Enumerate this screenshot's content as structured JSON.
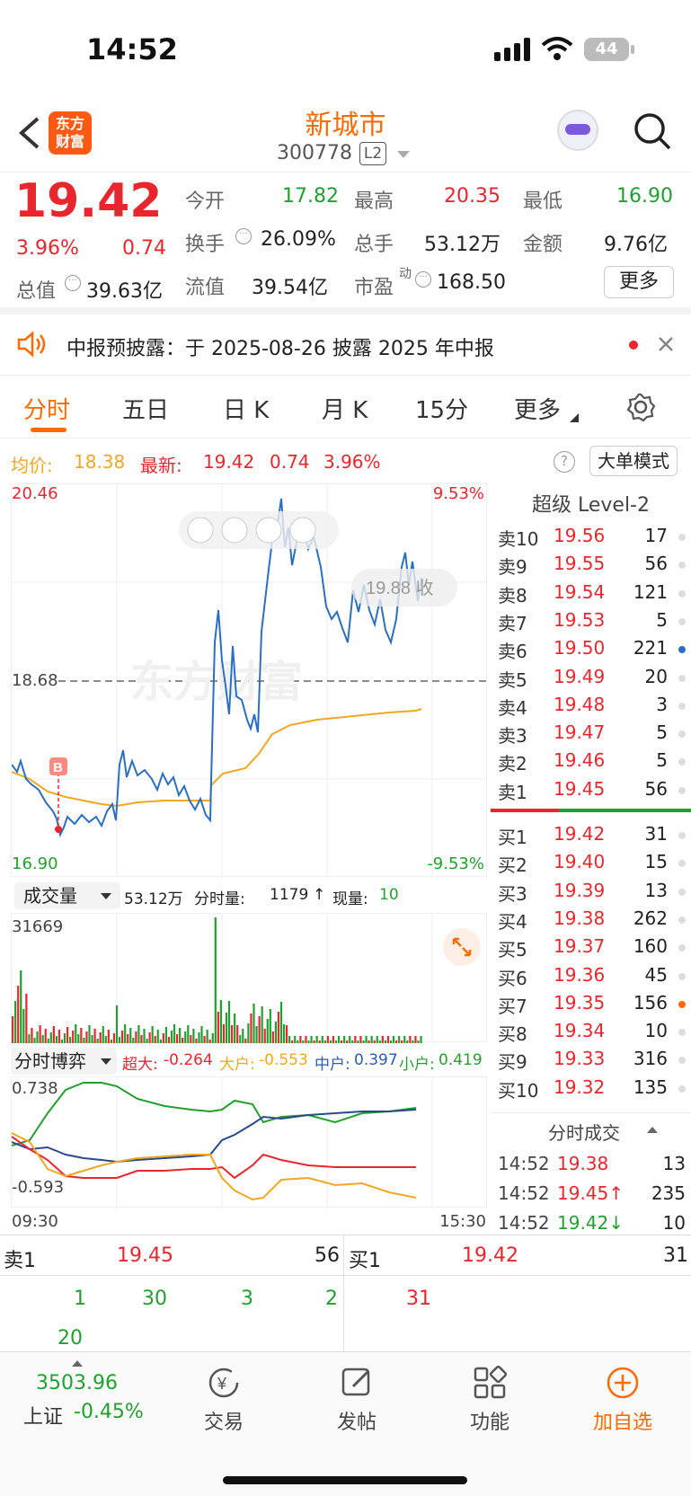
{
  "status_bar": {
    "time": "14:52",
    "battery": "44"
  },
  "header": {
    "logo_line1": "东方",
    "logo_line2": "财富",
    "stock_name": "新城市",
    "stock_code": "300778",
    "level_badge": "L2"
  },
  "quote": {
    "price": "19.42",
    "change_pct": "3.96%",
    "change": "0.74",
    "open_label": "今开",
    "open": "17.82",
    "high_label": "最高",
    "high": "20.35",
    "low_label": "最低",
    "low": "16.90",
    "turnover_label": "换手",
    "turnover": "26.09%",
    "volume_label": "总手",
    "volume": "53.12万",
    "amount_label": "金额",
    "amount": "9.76亿",
    "mktcap_label": "总值",
    "mktcap": "39.63亿",
    "float_label": "流值",
    "float": "39.54亿",
    "pe_label": "市盈",
    "pe_sup": "动",
    "pe": "168.50",
    "more_button": "更多"
  },
  "notice": {
    "text": "中报预披露：于 2025-08-26 披露 2025 年中报"
  },
  "tabs": [
    "分时",
    "五日",
    "日 K",
    "月 K",
    "15分",
    "更多"
  ],
  "avg_line": {
    "avg_label": "均价:",
    "avg": "18.38",
    "latest_label": "最新:",
    "latest": "19.42",
    "latest_chg": "0.74",
    "latest_pct": "3.96%",
    "big_order_button": "大单模式"
  },
  "chart": {
    "y_max": "20.46",
    "y_min": "16.90",
    "pct_max": "9.53%",
    "pct_min": "-9.53%",
    "prev_close": "18.68",
    "close_tag": "19.88 收",
    "buy_marker": "B",
    "watermark": "东方财富",
    "time_start": "09:30",
    "time_end": "15:30"
  },
  "volume_bar": {
    "dropdown": "成交量",
    "total": "53.12万",
    "tick_label": "分时量:",
    "tick_vol": "1179",
    "now_label": "现量:",
    "now_vol": "10",
    "y_max": "31669"
  },
  "bo_bar": {
    "dropdown": "分时博弈",
    "super_label": "超大:",
    "super": "-0.264",
    "large_label": "大户:",
    "large": "-0.553",
    "mid_label": "中户:",
    "mid": "0.397",
    "small_label": "小户:",
    "small": "0.419",
    "y_max": "0.738",
    "y_min": "-0.593"
  },
  "orderbook": {
    "title": "超级 Level-2",
    "asks": [
      {
        "label": "卖10",
        "price": "19.56",
        "vol": "17"
      },
      {
        "label": "卖9",
        "price": "19.55",
        "vol": "56"
      },
      {
        "label": "卖8",
        "price": "19.54",
        "vol": "121"
      },
      {
        "label": "卖7",
        "price": "19.53",
        "vol": "5"
      },
      {
        "label": "卖6",
        "price": "19.50",
        "vol": "221"
      },
      {
        "label": "卖5",
        "price": "19.49",
        "vol": "20"
      },
      {
        "label": "卖4",
        "price": "19.48",
        "vol": "3"
      },
      {
        "label": "卖3",
        "price": "19.47",
        "vol": "5"
      },
      {
        "label": "卖2",
        "price": "19.46",
        "vol": "5"
      },
      {
        "label": "卖1",
        "price": "19.45",
        "vol": "56"
      }
    ],
    "bids": [
      {
        "label": "买1",
        "price": "19.42",
        "vol": "31"
      },
      {
        "label": "买2",
        "price": "19.40",
        "vol": "15"
      },
      {
        "label": "买3",
        "price": "19.39",
        "vol": "13"
      },
      {
        "label": "买4",
        "price": "19.38",
        "vol": "262"
      },
      {
        "label": "买5",
        "price": "19.37",
        "vol": "160"
      },
      {
        "label": "买6",
        "price": "19.36",
        "vol": "45"
      },
      {
        "label": "买7",
        "price": "19.35",
        "vol": "156"
      },
      {
        "label": "买8",
        "price": "19.34",
        "vol": "10"
      },
      {
        "label": "买9",
        "price": "19.33",
        "vol": "316"
      },
      {
        "label": "买10",
        "price": "19.32",
        "vol": "135"
      }
    ]
  },
  "ticks": {
    "title": "分时成交",
    "rows": [
      {
        "time": "14:52",
        "price": "19.38",
        "vol": "13"
      },
      {
        "time": "14:52",
        "price": "19.45↑",
        "vol": "235"
      },
      {
        "time": "14:52",
        "price": "19.42↓",
        "vol": "10"
      }
    ]
  },
  "summary": {
    "sell_label": "卖1",
    "sell_price": "19.45",
    "sell_vol": "56",
    "buy_label": "买1",
    "buy_price": "19.42",
    "buy_vol": "31",
    "sell_queue": [
      "1",
      "30",
      "3",
      "2",
      "20"
    ],
    "buy_queue": [
      "31"
    ]
  },
  "bottom_nav": {
    "index_value": "3503.96",
    "index_name": "上证",
    "index_pct": "-0.45%",
    "trade": "交易",
    "post": "发帖",
    "func": "功能",
    "add": "加自选"
  }
}
